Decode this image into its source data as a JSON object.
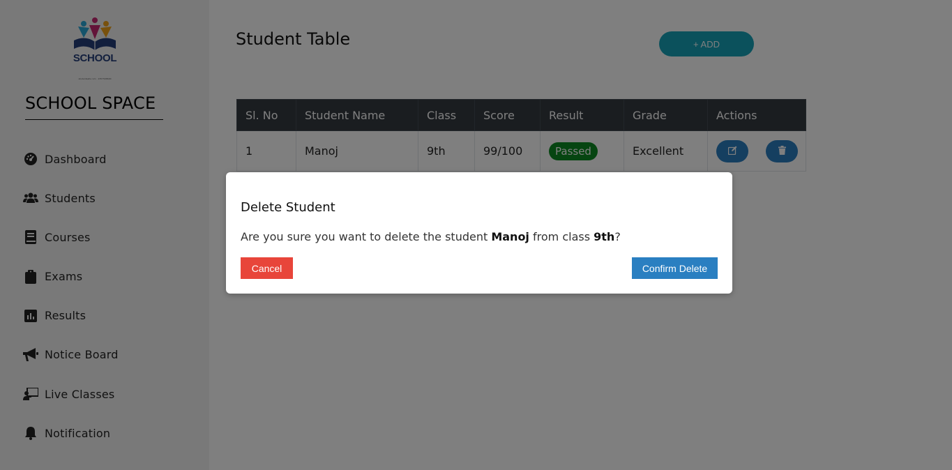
{
  "brand": {
    "logo_text": "SCHOOL",
    "logo_tagline": "studentsafe.com · 2357508600",
    "name": "SCHOOL SPACE"
  },
  "sidebar": {
    "items": [
      {
        "label": "Dashboard",
        "icon": "dashboard-icon"
      },
      {
        "label": "Students",
        "icon": "users-icon"
      },
      {
        "label": "Courses",
        "icon": "book-icon"
      },
      {
        "label": "Exams",
        "icon": "clipboard-icon"
      },
      {
        "label": "Results",
        "icon": "chart-icon"
      },
      {
        "label": "Notice Board",
        "icon": "megaphone-icon"
      },
      {
        "label": "Live Classes",
        "icon": "presentation-icon"
      },
      {
        "label": "Notification",
        "icon": "bell-icon"
      }
    ]
  },
  "main": {
    "title": "Student Table",
    "add_label": "+ ADD"
  },
  "table": {
    "headers": [
      "Sl. No",
      "Student Name",
      "Class",
      "Score",
      "Result",
      "Grade",
      "Actions"
    ],
    "rows": [
      {
        "sl": "1",
        "name": "Manoj",
        "class": "9th",
        "score": "99/100",
        "result": "Passed",
        "grade": "Excellent"
      }
    ]
  },
  "modal": {
    "title": "Delete Student",
    "msg_prefix": "Are you sure you want to delete the student ",
    "msg_name": "Manoj",
    "msg_mid": " from class ",
    "msg_class": "9th",
    "msg_suffix": "?",
    "cancel_label": "Cancel",
    "confirm_label": "Confirm Delete"
  },
  "colors": {
    "sidebar_bg": "#f3f3f3",
    "accent": "#17a2b8",
    "primary": "#2a7fc1",
    "danger": "#e8453a",
    "success": "#0c8a22",
    "table_header": "#343a40"
  }
}
